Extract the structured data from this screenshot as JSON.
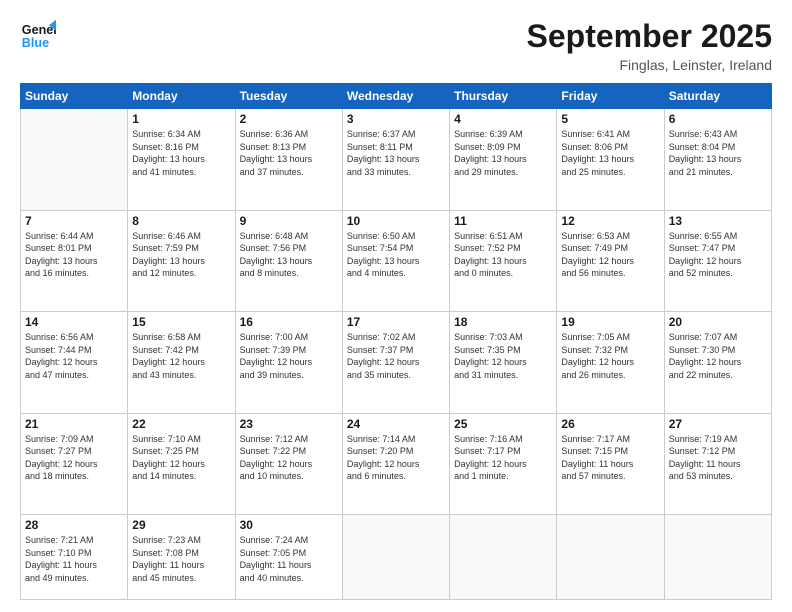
{
  "header": {
    "logo_line1": "General",
    "logo_line2": "Blue",
    "month": "September 2025",
    "location": "Finglas, Leinster, Ireland"
  },
  "days_of_week": [
    "Sunday",
    "Monday",
    "Tuesday",
    "Wednesday",
    "Thursday",
    "Friday",
    "Saturday"
  ],
  "weeks": [
    [
      {
        "day": "",
        "info": ""
      },
      {
        "day": "1",
        "info": "Sunrise: 6:34 AM\nSunset: 8:16 PM\nDaylight: 13 hours\nand 41 minutes."
      },
      {
        "day": "2",
        "info": "Sunrise: 6:36 AM\nSunset: 8:13 PM\nDaylight: 13 hours\nand 37 minutes."
      },
      {
        "day": "3",
        "info": "Sunrise: 6:37 AM\nSunset: 8:11 PM\nDaylight: 13 hours\nand 33 minutes."
      },
      {
        "day": "4",
        "info": "Sunrise: 6:39 AM\nSunset: 8:09 PM\nDaylight: 13 hours\nand 29 minutes."
      },
      {
        "day": "5",
        "info": "Sunrise: 6:41 AM\nSunset: 8:06 PM\nDaylight: 13 hours\nand 25 minutes."
      },
      {
        "day": "6",
        "info": "Sunrise: 6:43 AM\nSunset: 8:04 PM\nDaylight: 13 hours\nand 21 minutes."
      }
    ],
    [
      {
        "day": "7",
        "info": "Sunrise: 6:44 AM\nSunset: 8:01 PM\nDaylight: 13 hours\nand 16 minutes."
      },
      {
        "day": "8",
        "info": "Sunrise: 6:46 AM\nSunset: 7:59 PM\nDaylight: 13 hours\nand 12 minutes."
      },
      {
        "day": "9",
        "info": "Sunrise: 6:48 AM\nSunset: 7:56 PM\nDaylight: 13 hours\nand 8 minutes."
      },
      {
        "day": "10",
        "info": "Sunrise: 6:50 AM\nSunset: 7:54 PM\nDaylight: 13 hours\nand 4 minutes."
      },
      {
        "day": "11",
        "info": "Sunrise: 6:51 AM\nSunset: 7:52 PM\nDaylight: 13 hours\nand 0 minutes."
      },
      {
        "day": "12",
        "info": "Sunrise: 6:53 AM\nSunset: 7:49 PM\nDaylight: 12 hours\nand 56 minutes."
      },
      {
        "day": "13",
        "info": "Sunrise: 6:55 AM\nSunset: 7:47 PM\nDaylight: 12 hours\nand 52 minutes."
      }
    ],
    [
      {
        "day": "14",
        "info": "Sunrise: 6:56 AM\nSunset: 7:44 PM\nDaylight: 12 hours\nand 47 minutes."
      },
      {
        "day": "15",
        "info": "Sunrise: 6:58 AM\nSunset: 7:42 PM\nDaylight: 12 hours\nand 43 minutes."
      },
      {
        "day": "16",
        "info": "Sunrise: 7:00 AM\nSunset: 7:39 PM\nDaylight: 12 hours\nand 39 minutes."
      },
      {
        "day": "17",
        "info": "Sunrise: 7:02 AM\nSunset: 7:37 PM\nDaylight: 12 hours\nand 35 minutes."
      },
      {
        "day": "18",
        "info": "Sunrise: 7:03 AM\nSunset: 7:35 PM\nDaylight: 12 hours\nand 31 minutes."
      },
      {
        "day": "19",
        "info": "Sunrise: 7:05 AM\nSunset: 7:32 PM\nDaylight: 12 hours\nand 26 minutes."
      },
      {
        "day": "20",
        "info": "Sunrise: 7:07 AM\nSunset: 7:30 PM\nDaylight: 12 hours\nand 22 minutes."
      }
    ],
    [
      {
        "day": "21",
        "info": "Sunrise: 7:09 AM\nSunset: 7:27 PM\nDaylight: 12 hours\nand 18 minutes."
      },
      {
        "day": "22",
        "info": "Sunrise: 7:10 AM\nSunset: 7:25 PM\nDaylight: 12 hours\nand 14 minutes."
      },
      {
        "day": "23",
        "info": "Sunrise: 7:12 AM\nSunset: 7:22 PM\nDaylight: 12 hours\nand 10 minutes."
      },
      {
        "day": "24",
        "info": "Sunrise: 7:14 AM\nSunset: 7:20 PM\nDaylight: 12 hours\nand 6 minutes."
      },
      {
        "day": "25",
        "info": "Sunrise: 7:16 AM\nSunset: 7:17 PM\nDaylight: 12 hours\nand 1 minute."
      },
      {
        "day": "26",
        "info": "Sunrise: 7:17 AM\nSunset: 7:15 PM\nDaylight: 11 hours\nand 57 minutes."
      },
      {
        "day": "27",
        "info": "Sunrise: 7:19 AM\nSunset: 7:12 PM\nDaylight: 11 hours\nand 53 minutes."
      }
    ],
    [
      {
        "day": "28",
        "info": "Sunrise: 7:21 AM\nSunset: 7:10 PM\nDaylight: 11 hours\nand 49 minutes."
      },
      {
        "day": "29",
        "info": "Sunrise: 7:23 AM\nSunset: 7:08 PM\nDaylight: 11 hours\nand 45 minutes."
      },
      {
        "day": "30",
        "info": "Sunrise: 7:24 AM\nSunset: 7:05 PM\nDaylight: 11 hours\nand 40 minutes."
      },
      {
        "day": "",
        "info": ""
      },
      {
        "day": "",
        "info": ""
      },
      {
        "day": "",
        "info": ""
      },
      {
        "day": "",
        "info": ""
      }
    ]
  ]
}
